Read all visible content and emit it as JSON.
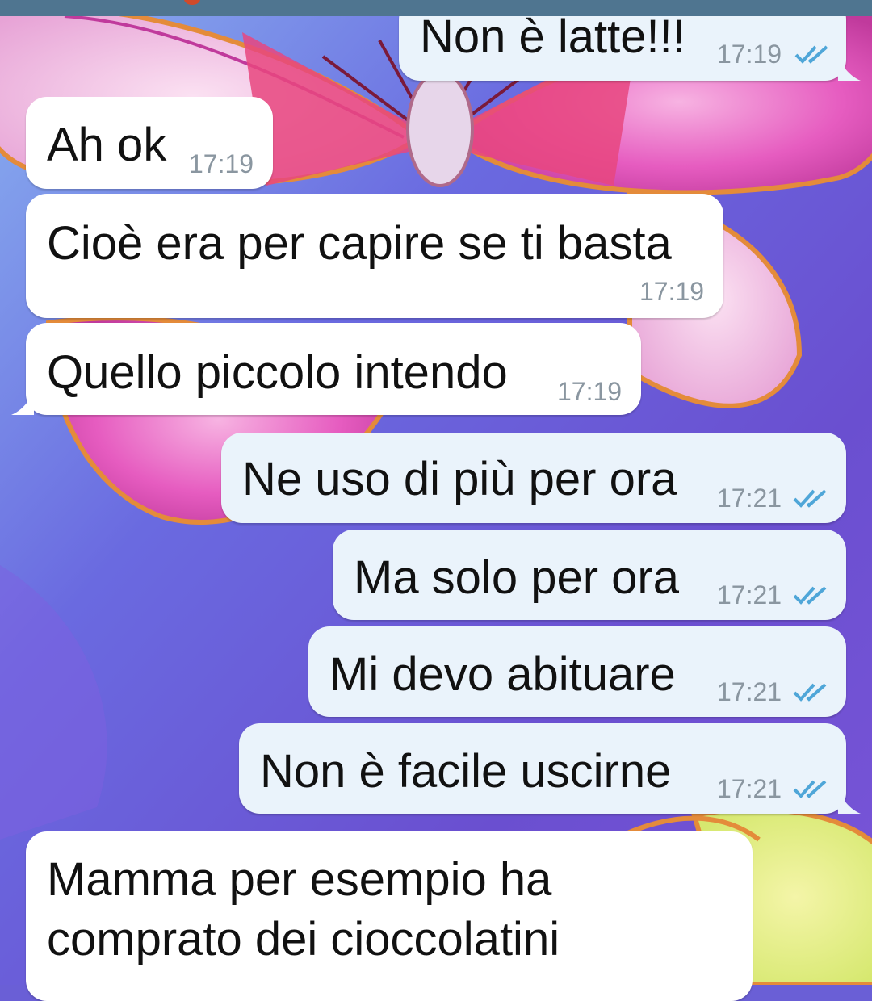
{
  "colors": {
    "incoming_bubble": "#ffffff",
    "outgoing_bubble": "#eaf3fb",
    "time_text": "#8a96a0",
    "read_checks": "#4fa6d8",
    "top_bar": "#4f7590"
  },
  "icons": {
    "read": "double-check-icon"
  },
  "messages": [
    {
      "direction": "outgoing",
      "text": "Non è latte!!!",
      "time": "17:19"
    },
    {
      "direction": "incoming",
      "text": "Ah ok",
      "time": "17:19"
    },
    {
      "direction": "incoming",
      "text": "Cioè era per capire se ti basta",
      "time": "17:19"
    },
    {
      "direction": "incoming",
      "text": "Quello piccolo intendo",
      "time": "17:19"
    },
    {
      "direction": "outgoing",
      "text": "Ne uso di più per ora",
      "time": "17:21"
    },
    {
      "direction": "outgoing",
      "text": "Ma solo per ora",
      "time": "17:21"
    },
    {
      "direction": "outgoing",
      "text": "Mi devo abituare",
      "time": "17:21"
    },
    {
      "direction": "outgoing",
      "text": "Non è facile uscirne",
      "time": "17:21"
    },
    {
      "direction": "incoming",
      "lines": [
        "Mamma per esempio ha",
        "comprato dei cioccolatini"
      ]
    }
  ]
}
